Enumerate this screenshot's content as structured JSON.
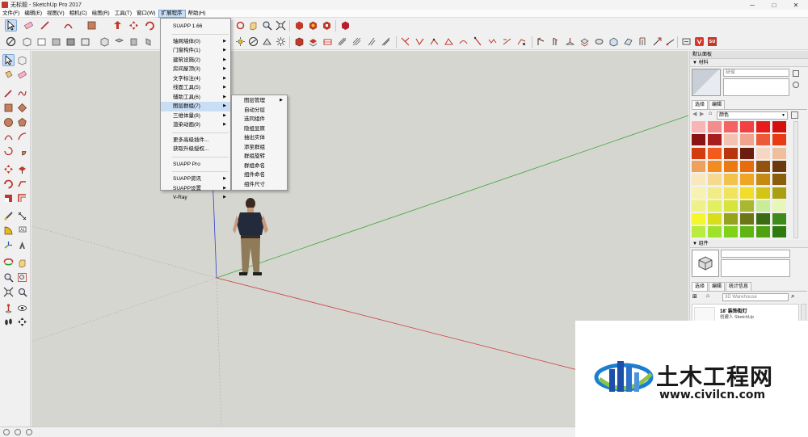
{
  "window": {
    "title": "无标题 - SketchUp Pro 2017",
    "controls": [
      "minimize-icon",
      "maximize-icon",
      "close-icon"
    ]
  },
  "menubar": {
    "items": [
      "文件(F)",
      "编辑(E)",
      "视图(V)",
      "相机(C)",
      "绘图(R)",
      "工具(T)",
      "窗口(W)",
      "扩展程序",
      "帮助(H)"
    ],
    "active_index": 7
  },
  "extensions_menu": {
    "items": [
      {
        "label": "SUAPP 1.66",
        "submenu": false
      },
      {
        "sep": true
      },
      {
        "label": "轴网墙体(0)",
        "submenu": true
      },
      {
        "label": "门窗构件(1)",
        "submenu": true
      },
      {
        "label": "建筑设施(2)",
        "submenu": true
      },
      {
        "label": "房间屋顶(3)",
        "submenu": true
      },
      {
        "label": "文字标注(4)",
        "submenu": true
      },
      {
        "label": "线面工具(5)",
        "submenu": true
      },
      {
        "label": "辅助工具(6)",
        "submenu": true
      },
      {
        "label": "图层群组(7)",
        "submenu": true,
        "highlighted": true
      },
      {
        "label": "三维体量(8)",
        "submenu": true
      },
      {
        "label": "渲染动画(9)",
        "submenu": true
      },
      {
        "sep": true
      },
      {
        "label": "更多高级插件...",
        "submenu": false
      },
      {
        "label": "获取升级授权...",
        "submenu": false
      },
      {
        "sep": true
      },
      {
        "label": "SUAPP Pro",
        "submenu": false
      },
      {
        "sep": true
      },
      {
        "label": "SUAPP资讯",
        "submenu": true
      },
      {
        "label": "SUAPP设置",
        "submenu": true
      },
      {
        "label": "V-Ray",
        "submenu": true
      }
    ]
  },
  "layers_submenu": {
    "items": [
      {
        "label": "图层管理",
        "submenu": true
      },
      {
        "label": "自动分层",
        "submenu": false
      },
      {
        "label": "选同组件",
        "submenu": false
      },
      {
        "label": "隐组显原",
        "submenu": false
      },
      {
        "label": "抽出实体",
        "submenu": false
      },
      {
        "label": "添至群组",
        "submenu": false
      },
      {
        "label": "群组旋转",
        "submenu": false
      },
      {
        "label": "群组命名",
        "submenu": false
      },
      {
        "label": "组件命名",
        "submenu": false
      },
      {
        "label": "组件尺寸",
        "submenu": false
      }
    ]
  },
  "right_panel": {
    "default_tray": "默认面板",
    "materials": {
      "title": "材料",
      "name_placeholder": "缺省",
      "tabs": [
        "选择",
        "编辑"
      ],
      "library": "颜色",
      "swatches": [
        "#f7b5b5",
        "#f38c8c",
        "#f26464",
        "#f24141",
        "#e81c1c",
        "#d40f0f",
        "#8c1313",
        "#a81d1d",
        "#f2c2b3",
        "#f0a38e",
        "#ec5b36",
        "#e83b14",
        "#d23c0f",
        "#f35a1b",
        "#b8350f",
        "#6d1d0d",
        "#f6d7c3",
        "#eebf9e",
        "#eea15c",
        "#f28b20",
        "#ec7a12",
        "#e86c0c",
        "#93520f",
        "#6b3a0c",
        "#f9e8bf",
        "#f4d98f",
        "#f3c24b",
        "#f0a622",
        "#c68a12",
        "#8b5e0e",
        "#f7f1b2",
        "#f2ec87",
        "#f0e45d",
        "#f1dd2a",
        "#d4c414",
        "#a99f12",
        "#eef18a",
        "#e2ef5f",
        "#d6e43b",
        "#a9b82f",
        "#c8ec98",
        "#e6f7b8",
        "#f3f72b",
        "#d8de1a",
        "#96a41d",
        "#6c7616",
        "#3b6b12",
        "#3d8c1b",
        "#b9ec3f",
        "#9ee22a",
        "#7fd11a",
        "#5fb513",
        "#4ea211",
        "#2f7a0e"
      ]
    },
    "components": {
      "title": "组件",
      "tabs": [
        "选择",
        "编辑",
        "统计信息"
      ],
      "search_placeholder": "3D Warehouse",
      "result_title": "18' 装饰街灯",
      "result_sub": "创建人 SketchUp"
    }
  },
  "watermark": {
    "brand": "土木工程网",
    "url": "www.civilcn.com"
  }
}
